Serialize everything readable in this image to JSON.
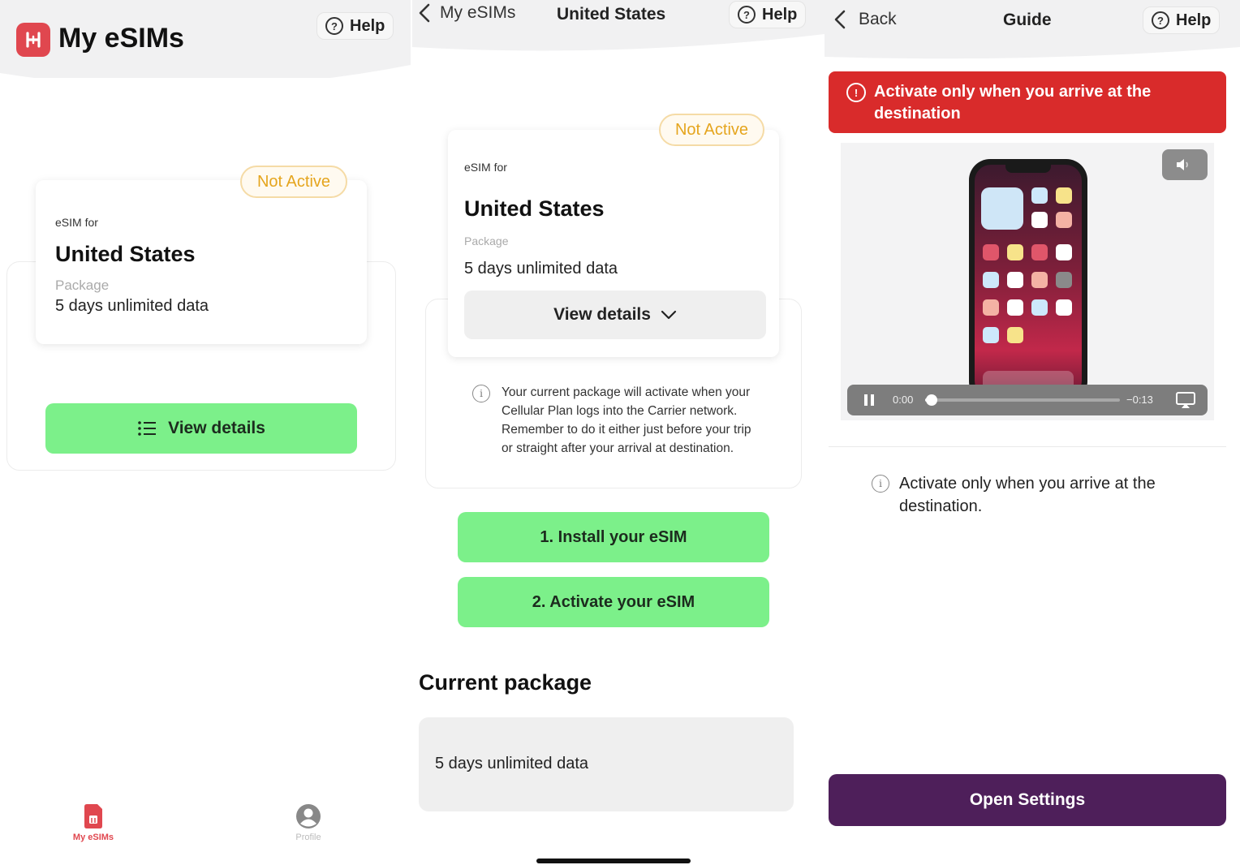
{
  "screen1": {
    "title": "My eSIMs",
    "help_label": "Help",
    "card": {
      "badge": "Not Active",
      "esim_for": "eSIM for",
      "country": "United States",
      "package_label": "Package",
      "package_value": "5 days unlimited data"
    },
    "view_details_label": "View details",
    "tabs": [
      {
        "label": "My eSIMs",
        "icon": "sim-card-icon",
        "active": true
      },
      {
        "label": "Profile",
        "icon": "user-circle-icon",
        "active": false
      }
    ],
    "accent_color": "#e0474f"
  },
  "screen2": {
    "back_label": "My eSIMs",
    "title": "United States",
    "help_label": "Help",
    "card": {
      "badge": "Not Active",
      "esim_for": "eSIM for",
      "country": "United States",
      "package_label": "Package",
      "package_value": "5 days unlimited data",
      "view_details_label": "View details"
    },
    "info_text": "Your current package will activate when your Cellular Plan logs into the Carrier network. Remember to do it either just before your trip or straight after your arrival at destination.",
    "install_label": "1. Install your eSIM",
    "activate_label": "2. Activate your eSIM",
    "current_package_heading": "Current package",
    "current_package_value": "5 days unlimited data"
  },
  "screen3": {
    "back_label": "Back",
    "title": "Guide",
    "help_label": "Help",
    "alert_text": "Activate only when you arrive at the destination",
    "video": {
      "elapsed": "0:00",
      "remaining": "−0:13",
      "progress": 0.02
    },
    "note_text": "Activate only when you arrive at the destination.",
    "open_settings_label": "Open Settings",
    "alert_color": "#d92b2b",
    "button_color": "#4e1f5a"
  }
}
